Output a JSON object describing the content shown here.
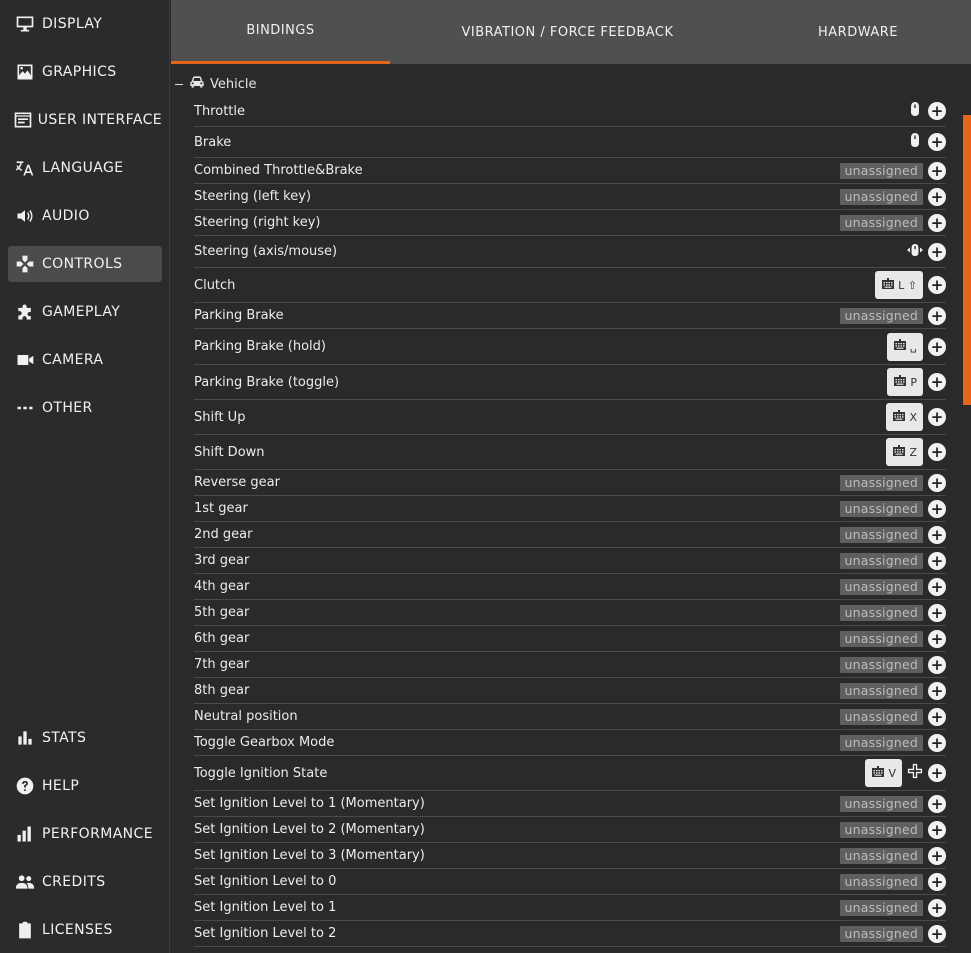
{
  "sidebar": {
    "top_items": [
      {
        "label": "DISPLAY",
        "icon": "monitor-icon"
      },
      {
        "label": "GRAPHICS",
        "icon": "image-icon"
      },
      {
        "label": "USER INTERFACE",
        "icon": "window-icon"
      },
      {
        "label": "LANGUAGE",
        "icon": "translate-icon"
      },
      {
        "label": "AUDIO",
        "icon": "speaker-icon"
      },
      {
        "label": "CONTROLS",
        "icon": "gamepad-icon",
        "active": true
      },
      {
        "label": "GAMEPLAY",
        "icon": "puzzle-icon"
      },
      {
        "label": "CAMERA",
        "icon": "camera-icon"
      },
      {
        "label": "OTHER",
        "icon": "dots-icon"
      }
    ],
    "bottom_items": [
      {
        "label": "STATS",
        "icon": "bar-chart-icon"
      },
      {
        "label": "HELP",
        "icon": "help-icon"
      },
      {
        "label": "PERFORMANCE",
        "icon": "performance-icon"
      },
      {
        "label": "CREDITS",
        "icon": "people-icon"
      },
      {
        "label": "LICENSES",
        "icon": "clipboard-icon"
      }
    ]
  },
  "tabs": [
    {
      "label": "BINDINGS",
      "active": true
    },
    {
      "label": "VIBRATION / FORCE FEEDBACK"
    },
    {
      "label": "HARDWARE"
    }
  ],
  "group": {
    "label": "Vehicle",
    "icon": "car-icon"
  },
  "unassigned_text": "unassigned",
  "rows": [
    {
      "label": "Throttle",
      "binding": {
        "type": "device",
        "icon": "mouse-icon"
      }
    },
    {
      "label": "Brake",
      "binding": {
        "type": "device",
        "icon": "mouse-icon"
      }
    },
    {
      "label": "Combined Throttle&Brake",
      "binding": {
        "type": "unassigned"
      }
    },
    {
      "label": "Steering (left key)",
      "binding": {
        "type": "unassigned"
      }
    },
    {
      "label": "Steering (right key)",
      "binding": {
        "type": "unassigned"
      }
    },
    {
      "label": "Steering (axis/mouse)",
      "binding": {
        "type": "device",
        "icon": "mouse-axis-icon"
      }
    },
    {
      "label": "Clutch",
      "binding": {
        "type": "key",
        "key": "L ⇧"
      }
    },
    {
      "label": "Parking Brake",
      "binding": {
        "type": "unassigned"
      }
    },
    {
      "label": "Parking Brake (hold)",
      "binding": {
        "type": "key",
        "key": "␣"
      }
    },
    {
      "label": "Parking Brake (toggle)",
      "binding": {
        "type": "key",
        "key": "P"
      }
    },
    {
      "label": "Shift Up",
      "binding": {
        "type": "key",
        "key": "X"
      }
    },
    {
      "label": "Shift Down",
      "binding": {
        "type": "key",
        "key": "Z"
      }
    },
    {
      "label": "Reverse gear",
      "binding": {
        "type": "unassigned"
      }
    },
    {
      "label": "1st gear",
      "binding": {
        "type": "unassigned"
      }
    },
    {
      "label": "2nd gear",
      "binding": {
        "type": "unassigned"
      }
    },
    {
      "label": "3rd gear",
      "binding": {
        "type": "unassigned"
      }
    },
    {
      "label": "4th gear",
      "binding": {
        "type": "unassigned"
      }
    },
    {
      "label": "5th gear",
      "binding": {
        "type": "unassigned"
      }
    },
    {
      "label": "6th gear",
      "binding": {
        "type": "unassigned"
      }
    },
    {
      "label": "7th gear",
      "binding": {
        "type": "unassigned"
      }
    },
    {
      "label": "8th gear",
      "binding": {
        "type": "unassigned"
      }
    },
    {
      "label": "Neutral position",
      "binding": {
        "type": "unassigned"
      }
    },
    {
      "label": "Toggle Gearbox Mode",
      "binding": {
        "type": "unassigned"
      }
    },
    {
      "label": "Toggle Ignition State",
      "binding": {
        "type": "key",
        "key": "V",
        "extra_icon": "dpad-icon"
      }
    },
    {
      "label": "Set Ignition Level to 1 (Momentary)",
      "binding": {
        "type": "unassigned"
      }
    },
    {
      "label": "Set Ignition Level to 2 (Momentary)",
      "binding": {
        "type": "unassigned"
      }
    },
    {
      "label": "Set Ignition Level to 3 (Momentary)",
      "binding": {
        "type": "unassigned"
      }
    },
    {
      "label": "Set Ignition Level to 0",
      "binding": {
        "type": "unassigned"
      }
    },
    {
      "label": "Set Ignition Level to 1",
      "binding": {
        "type": "unassigned"
      }
    },
    {
      "label": "Set Ignition Level to 2",
      "binding": {
        "type": "unassigned"
      }
    }
  ],
  "colors": {
    "accent": "#e5661a",
    "sidebar_bg": "#2b2b2b",
    "tabbar_bg": "#505050",
    "content_bg": "#2a2a2a"
  }
}
